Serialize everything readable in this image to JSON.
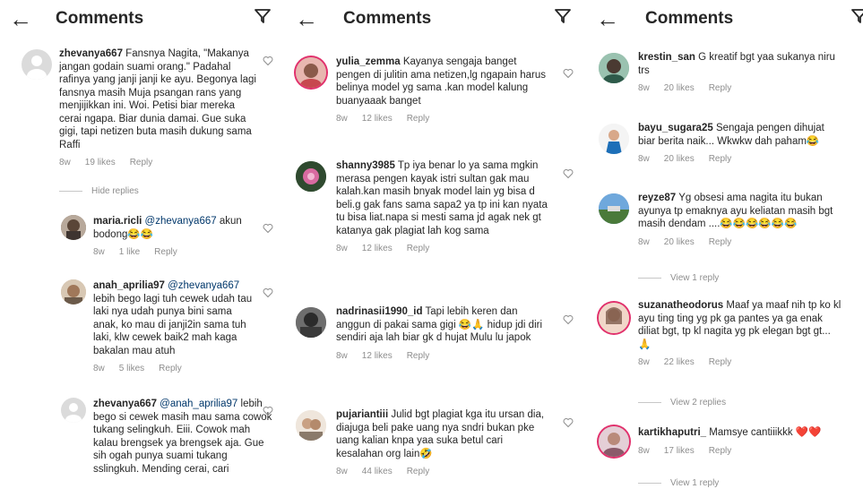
{
  "panels": [
    {
      "title": "Comments",
      "comments": [
        {
          "user": "zhevanya667",
          "mention": "",
          "text": "Fansnya Nagita, \"Makanya jangan godain suami orang.\" Padahal rafinya yang janji janji ke ayu. Begonya lagi fansnya masih Muja psangan rans yang menjijikkan ini. Woi. Petisi biar mereka cerai ngapa. Biar dunia damai. Gue suka gigi, tapi netizen buta masih dukung sama Raffi",
          "age": "8w",
          "likes": "19 likes",
          "reply": "Reply"
        },
        {
          "user": "maria.ricli",
          "mention": "@zhevanya667",
          "text": "akun bodong😂😂",
          "age": "8w",
          "likes": "1 like",
          "reply": "Reply"
        },
        {
          "user": "anah_aprilia97",
          "mention": "@zhevanya667",
          "text": "lebih bego lagi tuh cewek udah tau laki nya udah punya bini sama anak, ko mau di janji2in sama tuh laki, klw cewek baik2 mah kaga bakalan mau atuh",
          "age": "8w",
          "likes": "5 likes",
          "reply": "Reply"
        },
        {
          "user": "zhevanya667",
          "mention": "@anah_aprilia97",
          "text": "lebih bego si cewek masih mau sama cowok tukang selingkuh. Eiii. Cowok mah kalau brengsek ya brengsek aja. Gue sih ogah punya suami tukang sslingkuh. Mending cerai, cari",
          "age": "",
          "likes": "",
          "reply": ""
        }
      ],
      "toggles": [
        "Hide replies"
      ]
    },
    {
      "title": "Comments",
      "comments": [
        {
          "user": "yulia_zemma",
          "mention": "",
          "text": "Kayanya sengaja banget pengen di julitin ama netizen,lg ngapain harus belinya model yg sama .kan model kalung buanyaaak banget",
          "age": "8w",
          "likes": "12 likes",
          "reply": "Reply"
        },
        {
          "user": "shanny3985",
          "mention": "",
          "text": "Tp iya benar lo ya sama mgkin merasa pengen kayak istri sultan gak mau kalah.kan masih bnyak model lain yg bisa d beli.g gak fans sama sapa2 ya tp ini kan nyata tu bisa liat.napa si mesti sama jd agak nek gt katanya gak plagiat lah kog sama",
          "age": "8w",
          "likes": "12 likes",
          "reply": "Reply"
        },
        {
          "user": "nadrinasii1990_id",
          "mention": "",
          "text": "Tapi lebih keren dan anggun di pakai sama gigi 😂🙏 hidup jdi diri sendiri aja lah biar gk d hujat Mulu lu japok",
          "age": "8w",
          "likes": "12 likes",
          "reply": "Reply"
        },
        {
          "user": "pujariantiii",
          "mention": "",
          "text": "Julid bgt plagiat kga itu ursan dia, diajuga beli pake uang nya sndri bukan pke uang kalian knpa yaa suka betul cari kesalahan org lain🤣",
          "age": "8w",
          "likes": "44 likes",
          "reply": "Reply"
        }
      ]
    },
    {
      "title": "Comments",
      "comments": [
        {
          "user": "krestin_san",
          "mention": "",
          "text": "G kreatif bgt yaa sukanya niru trs",
          "age": "8w",
          "likes": "20 likes",
          "reply": "Reply"
        },
        {
          "user": "bayu_sugara25",
          "mention": "",
          "text": "Sengaja pengen dihujat biar berita naik... Wkwkw dah paham😂",
          "age": "8w",
          "likes": "20 likes",
          "reply": "Reply"
        },
        {
          "user": "reyze87",
          "mention": "",
          "text": "Yg obsesi ama nagita itu bukan ayunya tp emaknya ayu keliatan masih bgt masih dendam ....😂😂😂😂😂😂",
          "age": "8w",
          "likes": "20 likes",
          "reply": "Reply"
        },
        {
          "user": "suzanatheodorus",
          "mention": "",
          "text": "Maaf ya maaf nih tp ko kl ayu ting ting yg pk ga pantes ya ga enak diliat bgt, tp kl nagita yg pk elegan bgt gt... 🙏",
          "age": "8w",
          "likes": "22 likes",
          "reply": "Reply"
        },
        {
          "user": "kartikhaputri_",
          "mention": "",
          "text": "Mamsye cantiiikkk ❤️❤️",
          "age": "8w",
          "likes": "17 likes",
          "reply": "Reply"
        }
      ],
      "toggles": [
        "View 1 reply",
        "View 2 replies",
        "View 1 reply"
      ]
    }
  ]
}
